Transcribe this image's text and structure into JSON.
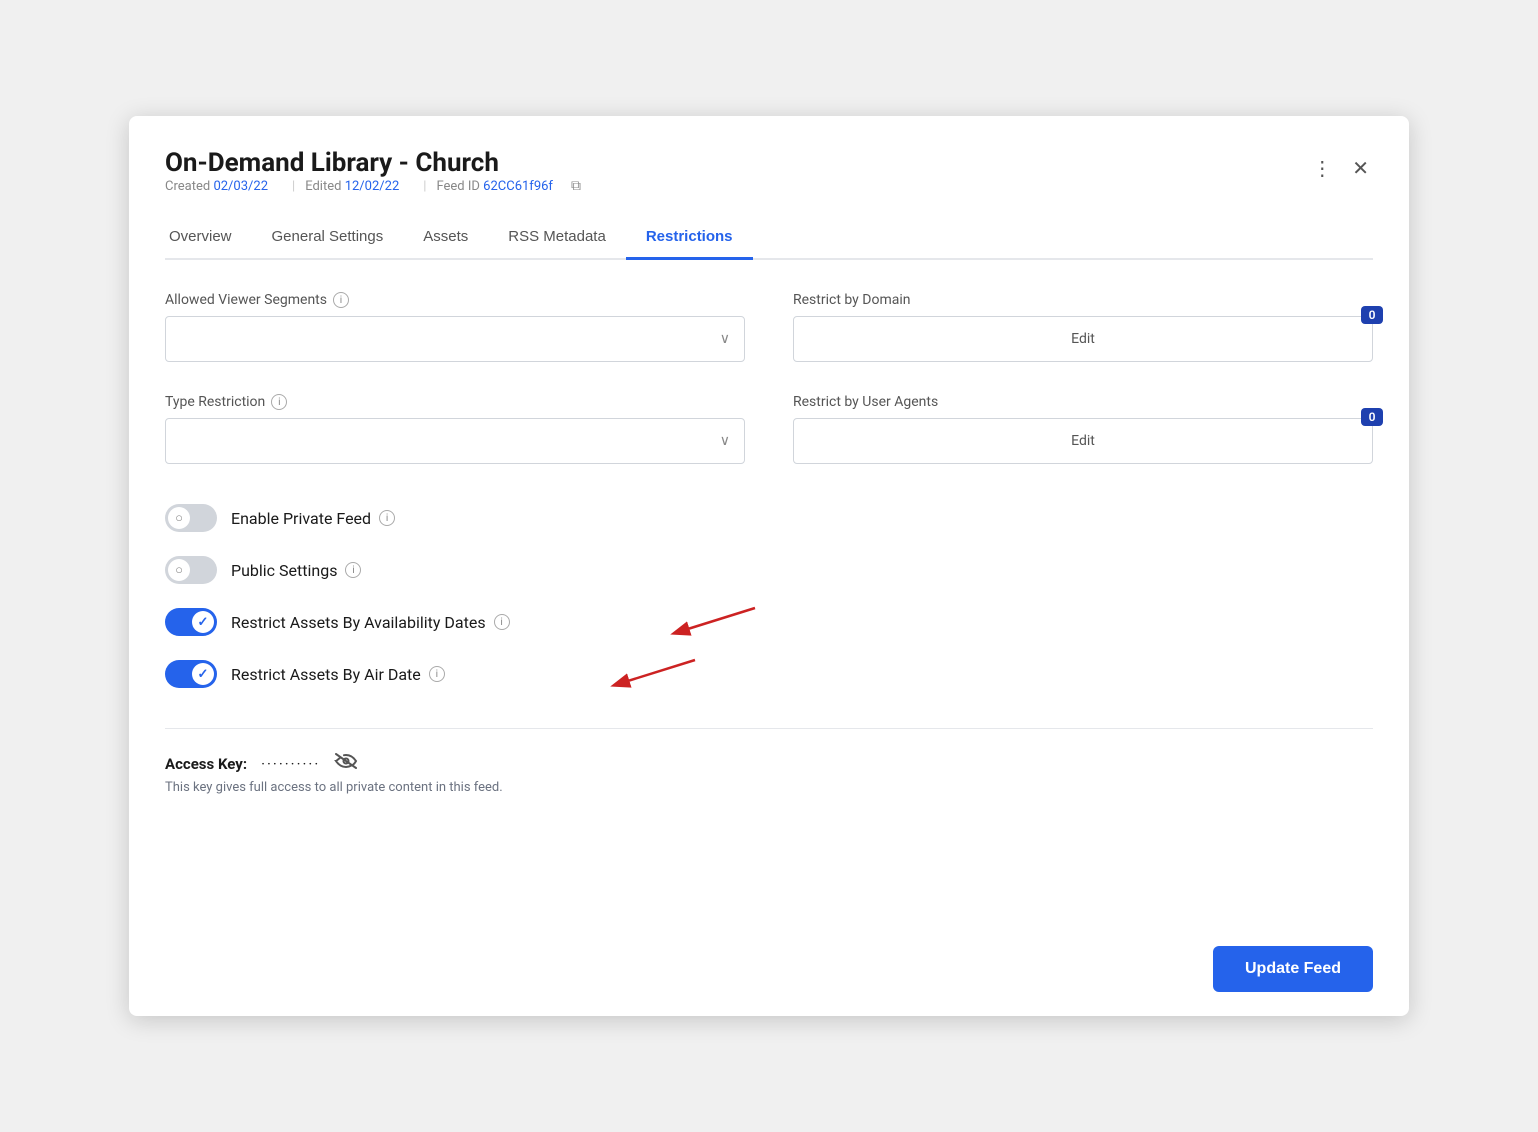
{
  "modal": {
    "title": "On-Demand Library - Church",
    "meta": {
      "created_label": "Created",
      "created_value": "02/03/22",
      "edited_label": "Edited",
      "edited_value": "12/02/22",
      "feed_id_label": "Feed ID",
      "feed_id_value": "62CC61f96f"
    }
  },
  "tabs": [
    {
      "id": "overview",
      "label": "Overview",
      "active": false
    },
    {
      "id": "general-settings",
      "label": "General Settings",
      "active": false
    },
    {
      "id": "assets",
      "label": "Assets",
      "active": false
    },
    {
      "id": "rss-metadata",
      "label": "RSS Metadata",
      "active": false
    },
    {
      "id": "restrictions",
      "label": "Restrictions",
      "active": true
    }
  ],
  "fields": {
    "allowed_viewer_segments": {
      "label": "Allowed Viewer Segments",
      "placeholder": ""
    },
    "restrict_by_domain": {
      "label": "Restrict by Domain",
      "edit_label": "Edit",
      "badge": "0"
    },
    "type_restriction": {
      "label": "Type Restriction",
      "placeholder": ""
    },
    "restrict_by_user_agents": {
      "label": "Restrict by User Agents",
      "edit_label": "Edit",
      "badge": "0"
    }
  },
  "toggles": [
    {
      "id": "enable-private-feed",
      "label": "Enable Private Feed",
      "state": "off",
      "has_info": true
    },
    {
      "id": "public-settings",
      "label": "Public Settings",
      "state": "off",
      "has_info": true
    },
    {
      "id": "restrict-by-availability-dates",
      "label": "Restrict Assets By Availability Dates",
      "state": "on",
      "has_info": true,
      "has_arrow": true
    },
    {
      "id": "restrict-by-air-date",
      "label": "Restrict Assets By Air Date",
      "state": "on",
      "has_info": true,
      "has_arrow": true
    }
  ],
  "access_key": {
    "label": "Access Key:",
    "dots": "··········",
    "hint": "This key gives full access to all private content in this feed."
  },
  "footer": {
    "update_button_label": "Update Feed"
  },
  "icons": {
    "more_icon": "⋮",
    "close_icon": "✕",
    "copy_icon": "⧉",
    "chevron_down": "∨",
    "info_icon": "i",
    "eye_slash_icon": "⊘"
  }
}
